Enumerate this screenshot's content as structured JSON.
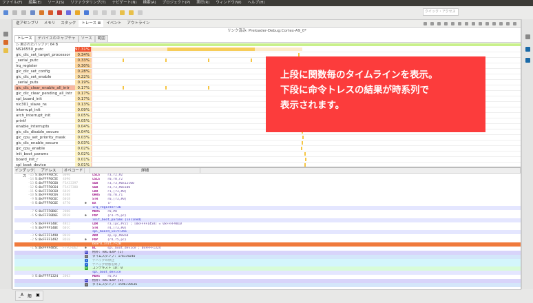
{
  "menu": [
    "ファイル(F)",
    "編集(E)",
    "ソース(S)",
    "リファクタリング(T)",
    "ナビゲート(N)",
    "検索(A)",
    "プロジェクト(P)",
    "実行(R)",
    "ウィンドウ(W)",
    "ヘルプ(H)"
  ],
  "quick_access_placeholder": "クイック・アクセス",
  "view_tabs": [
    {
      "label": "逆アセンブリ"
    },
    {
      "label": "メモリ"
    },
    {
      "label": "スタック"
    },
    {
      "label": "トレース ⊠",
      "active": true
    },
    {
      "label": "イベント"
    },
    {
      "label": "アウトライン"
    }
  ],
  "link_status": "リンク済み: Preloader-Debug:Cortex-A9_0*",
  "inner_tabs": [
    {
      "label": "トレース",
      "active": true
    },
    {
      "label": "デバイスのキャプチャ"
    },
    {
      "label": "ソース"
    },
    {
      "label": "範囲"
    }
  ],
  "buffer_label": "▷ 用されたバッファ: 64 B",
  "functions": [
    {
      "name": "NS16550_putc",
      "pct": "97.31%"
    },
    {
      "name": "gic_dic_set_target_processor",
      "pct": "0.34%"
    },
    {
      "name": "_serial_putc",
      "pct": "0.33%"
    },
    {
      "name": "irq_register",
      "pct": "0.30%"
    },
    {
      "name": "gic_dic_set_config",
      "pct": "0.28%"
    },
    {
      "name": "gic_dic_set_enable",
      "pct": "0.22%"
    },
    {
      "name": "_serial_puts",
      "pct": "0.19%"
    },
    {
      "name": "gic_dic_clear_enable_all_intr",
      "pct": "0.17%",
      "selected": true
    },
    {
      "name": "gic_dic_clear_pending_all_intr",
      "pct": "0.17%"
    },
    {
      "name": "spl_board_init",
      "pct": "0.17%"
    },
    {
      "name": "nic301_slave_ns",
      "pct": "0.13%"
    },
    {
      "name": "interrupt_init",
      "pct": "0.09%"
    },
    {
      "name": "arch_interrupt_init",
      "pct": "0.05%"
    },
    {
      "name": "printf",
      "pct": "0.05%"
    },
    {
      "name": "enable_interrupts",
      "pct": "0.04%"
    },
    {
      "name": "gic_dic_disable_secure",
      "pct": "0.04%"
    },
    {
      "name": "gic_cpu_set_priority_mask",
      "pct": "0.03%"
    },
    {
      "name": "gic_dic_enable_secure",
      "pct": "0.03%"
    },
    {
      "name": "gic_cpu_enable",
      "pct": "0.02%"
    },
    {
      "name": "init_boot_params",
      "pct": "0.02%"
    },
    {
      "name": "board_init_r",
      "pct": "0.01%"
    },
    {
      "name": "spl_boot_device",
      "pct": "0.01%"
    }
  ],
  "trace_headers": [
    "インデックス",
    "アドレス",
    "オペコード",
    "",
    "詳細"
  ],
  "trace_rows": [
    {
      "t": "i",
      "idx": "-15",
      "addr": "S:0xFFFF0C5C",
      "opc": "0090",
      "mn": "LSLS",
      "ops": "r3,r2,#2"
    },
    {
      "t": "i",
      "idx": "-14",
      "addr": "S:0xFFFF0C5E",
      "opc": "4090",
      "mn": "LSLS",
      "ops": "r0,r0,r2"
    },
    {
      "t": "i",
      "idx": "-13",
      "addr": "S:0xFFFF0C60",
      "opc": "F5A33397",
      "mn": "SUB",
      "ops": "r3,r3,#0x12c00"
    },
    {
      "t": "i",
      "idx": "-12",
      "addr": "S:0xFFFF0C64",
      "opc": "F5A37380",
      "mn": "SUB",
      "ops": "r3,r3,#0x100"
    },
    {
      "t": "i",
      "idx": "-11",
      "addr": "S:0xFFFF0C68",
      "opc": "6819",
      "mn": "LDR",
      "ops": "r1,[r3,#0]"
    },
    {
      "t": "i",
      "idx": "-10",
      "addr": "S:0xFFFF0C6A",
      "opc": "4308",
      "mn": "ORRS",
      "ops": "r0,r0,r1"
    },
    {
      "t": "i",
      "idx": "-9",
      "addr": "S:0xFFFF0C6C",
      "opc": "6018",
      "mn": "STR",
      "ops": "r0,[r3,#0]"
    },
    {
      "t": "i",
      "idx": "-8",
      "addr": "S:0xFFFF0C6E",
      "opc": "4770",
      "mn": "BX",
      "ops": "lr",
      "mark": "⊕"
    },
    {
      "t": "l",
      "text": "irq_register+36"
    },
    {
      "t": "i",
      "idx": "-7",
      "addr": "S:0xFFFF0D6C",
      "opc": "2000",
      "mn": "MOVS",
      "ops": "r0,#0"
    },
    {
      "t": "i",
      "idx": "-6",
      "addr": "S:0xFFFF0D6E",
      "opc": "BD38",
      "mn": "POP",
      "ops": "{r3-r5,pc}",
      "mark": "⊕"
    },
    {
      "t": "l",
      "text": "init_boot_params [inlined]"
    },
    {
      "t": "i",
      "idx": "-5",
      "addr": "S:0xFFFF140C",
      "opc": "4B12",
      "mn": "LDR",
      "ops": "r3,[pc,#72] ; [0xFFFF1458] = 0xFFFF9010"
    },
    {
      "t": "i",
      "idx": "-4",
      "addr": "S:0xFFFF140E",
      "opc": "601C",
      "mn": "STR",
      "ops": "r4,[r3,#0]"
    },
    {
      "t": "l",
      "text": "spl_board_init+356"
    },
    {
      "t": "i",
      "idx": "-3",
      "addr": "S:0xFFFF1490",
      "opc": "B018",
      "mn": "ADD",
      "ops": "sp,sp,#0x60"
    },
    {
      "t": "i",
      "idx": "-2",
      "addr": "S:0xFFFF1492",
      "opc": "BD38",
      "mn": "POP",
      "ops": "{r4,r5,pc}",
      "mark": "⊕"
    },
    {
      "t": "h",
      "text": "board_init_r+28"
    },
    {
      "t": "i",
      "idx": "-1",
      "addr": "S:0xFFFF485C",
      "opc": "F7FCFD62",
      "mn": "BL",
      "ops": "spl_boot_device ; 0xFFFF1324",
      "mark": "⊕"
    },
    {
      "t": "e1",
      "icon": "EX",
      "color": "#4646c8",
      "text": "例外: HALTEXP (1)"
    },
    {
      "t": "e4",
      "icon": "◷",
      "color": "#666",
      "text": "タイムスタンプ: 176178246"
    },
    {
      "t": "e2",
      "icon": "i",
      "color": "#2a6ad8",
      "text": "デバッグの停止"
    },
    {
      "t": "e2",
      "icon": "i",
      "color": "#2a6ad8",
      "text": "デバッグ状態を終了"
    },
    {
      "t": "e3",
      "icon": "ID",
      "color": "#2aa82a",
      "text": "コンテキスト ID: 0"
    },
    {
      "t": "l",
      "text": "spl_boot_device"
    },
    {
      "t": "i",
      "idx": "0",
      "addr": "S:0xFFFF1324",
      "opc": "2003",
      "mn": "MOVS",
      "ops": "r0,#3"
    },
    {
      "t": "e1",
      "icon": "EX",
      "color": "#4646c8",
      "text": "例外: HALTEXP (1)"
    },
    {
      "t": "e4",
      "icon": "◷",
      "color": "#666",
      "text": "タイムスタンプ: 1596739636"
    }
  ],
  "bottom_icons": [
    "_A",
    "般",
    "▣"
  ],
  "annotation": [
    "上段に関数毎のタイムラインを表示。",
    "下段に命令トレスの結果が時系列で",
    "表示されます。"
  ]
}
